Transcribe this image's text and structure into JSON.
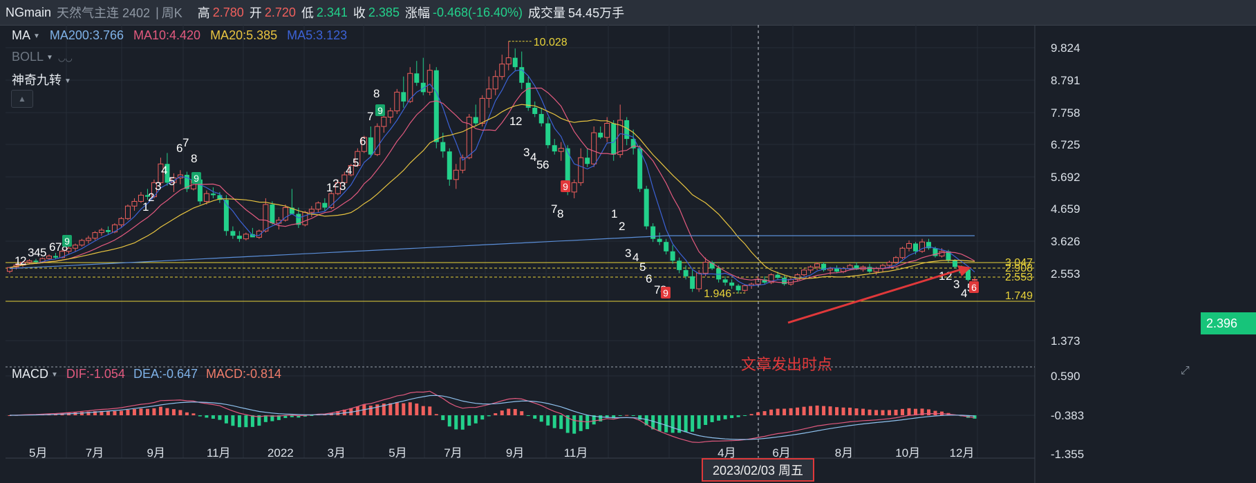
{
  "header": {
    "symbol": "NGmain",
    "name": "天然气主连 2402",
    "separator": "|",
    "period": "周K",
    "high_label": "高",
    "high": "2.780",
    "open_label": "开",
    "open": "2.720",
    "low_label": "低",
    "low": "2.341",
    "close_label": "收",
    "close": "2.385",
    "change_label": "涨幅",
    "change": "-0.468(-16.40%)",
    "volume_label": "成交量",
    "volume": "54.45万手"
  },
  "indicators": {
    "ma_label": "MA",
    "ma200": "MA200:3.766",
    "ma10": "MA10:4.420",
    "ma20": "MA20:5.385",
    "ma5": "MA5:3.123",
    "boll_label": "BOLL",
    "magic_label": "神奇九转"
  },
  "macd": {
    "label": "MACD",
    "dif": "DIF:-1.054",
    "dea": "DEA:-0.647",
    "macd": "MACD:-0.814"
  },
  "colors": {
    "up": "#f0605d",
    "down": "#23d18b",
    "ma200": "#5b8fd9",
    "ma10": "#e35a7f",
    "ma20": "#e8c440",
    "ma5": "#3c62d6"
  },
  "price_axis": [
    "9.824",
    "8.791",
    "7.758",
    "6.725",
    "5.692",
    "4.659",
    "3.626",
    "2.553"
  ],
  "macd_axis": [
    "1.373",
    "0.590",
    "-0.383",
    "-1.355"
  ],
  "current_price": "2.396",
  "levels": [
    {
      "label": "3.047",
      "value": 3.047
    },
    {
      "label": "2.908",
      "value": 2.908
    },
    {
      "label": "2.553",
      "value": 2.553
    },
    {
      "label": "1.749",
      "value": 1.749
    }
  ],
  "max_label": "10.028",
  "min_label": "1.946",
  "time_axis": [
    "5月",
    "7月",
    "9月",
    "11月",
    "2022",
    "3月",
    "5月",
    "7月",
    "9月",
    "11月",
    "4月",
    "6月",
    "8月",
    "10月",
    "12月"
  ],
  "crosshair_date": "2023/02/03 周五",
  "annotation": "文章发出时点",
  "nine_labels": [
    {
      "t": "1",
      "x": 21,
      "y": 378
    },
    {
      "t": "2",
      "x": 29,
      "y": 378
    },
    {
      "t": "3",
      "x": 40,
      "y": 366
    },
    {
      "t": "4",
      "x": 49,
      "y": 366
    },
    {
      "t": "5",
      "x": 58,
      "y": 366
    },
    {
      "t": "6",
      "x": 71,
      "y": 358
    },
    {
      "t": "7",
      "x": 80,
      "y": 358
    },
    {
      "t": "8",
      "x": 89,
      "y": 358
    },
    {
      "t": "1",
      "x": 206,
      "y": 300
    },
    {
      "t": "2",
      "x": 214,
      "y": 286
    },
    {
      "t": "3",
      "x": 224,
      "y": 270
    },
    {
      "t": "4",
      "x": 233,
      "y": 247
    },
    {
      "t": "5",
      "x": 244,
      "y": 263
    },
    {
      "t": "6",
      "x": 255,
      "y": 215
    },
    {
      "t": "7",
      "x": 264,
      "y": 207
    },
    {
      "t": "8",
      "x": 276,
      "y": 230
    },
    {
      "t": "1",
      "x": 472,
      "y": 272
    },
    {
      "t": "2",
      "x": 481,
      "y": 266
    },
    {
      "t": "3",
      "x": 491,
      "y": 270
    },
    {
      "t": "4",
      "x": 500,
      "y": 247
    },
    {
      "t": "5",
      "x": 510,
      "y": 236
    },
    {
      "t": "6",
      "x": 520,
      "y": 205
    },
    {
      "t": "7",
      "x": 531,
      "y": 169
    },
    {
      "t": "8",
      "x": 540,
      "y": 136
    },
    {
      "t": "1",
      "x": 737,
      "y": 176
    },
    {
      "t": "2",
      "x": 746,
      "y": 176
    },
    {
      "t": "3",
      "x": 757,
      "y": 221
    },
    {
      "t": "4",
      "x": 767,
      "y": 228
    },
    {
      "t": "5",
      "x": 776,
      "y": 239
    },
    {
      "t": "6",
      "x": 785,
      "y": 239
    },
    {
      "t": "7",
      "x": 797,
      "y": 303
    },
    {
      "t": "8",
      "x": 806,
      "y": 310
    },
    {
      "t": "1",
      "x": 884,
      "y": 310
    },
    {
      "t": "2",
      "x": 895,
      "y": 328
    },
    {
      "t": "3",
      "x": 904,
      "y": 367
    },
    {
      "t": "4",
      "x": 915,
      "y": 373
    },
    {
      "t": "5",
      "x": 925,
      "y": 387
    },
    {
      "t": "6",
      "x": 934,
      "y": 404
    },
    {
      "t": "7",
      "x": 946,
      "y": 420
    },
    {
      "t": "8",
      "x": 955,
      "y": 420
    },
    {
      "t": "1",
      "x": 1358,
      "y": 400
    },
    {
      "t": "2",
      "x": 1368,
      "y": 400
    },
    {
      "t": "3",
      "x": 1379,
      "y": 412
    },
    {
      "t": "4",
      "x": 1390,
      "y": 425
    },
    {
      "t": "5",
      "x": 1399,
      "y": 417
    }
  ],
  "nine_badges": [
    {
      "t": "9",
      "x": 97,
      "y": 349,
      "c": "#17a66b"
    },
    {
      "t": "9",
      "x": 284,
      "y": 258,
      "c": "#17a66b"
    },
    {
      "t": "9",
      "x": 550,
      "y": 160,
      "c": "#17a66b"
    },
    {
      "t": "9",
      "x": 818,
      "y": 270,
      "c": "#e0383a"
    },
    {
      "t": "9",
      "x": 963,
      "y": 424,
      "c": "#e0383a"
    },
    {
      "t": "6",
      "x": 1409,
      "y": 416,
      "c": "#e0383a"
    }
  ],
  "chart_data": {
    "type": "candlestick",
    "title": "NGmain 天然气主连 2402 周K",
    "period": "weekly",
    "x_range": [
      "2021-04",
      "2023-12"
    ],
    "y_range": [
      1.5,
      10.4
    ],
    "scale": "linear",
    "grid": true,
    "series": [
      {
        "name": "MA200",
        "last": 3.766
      },
      {
        "name": "MA10",
        "last": 4.42
      },
      {
        "name": "MA20",
        "last": 5.385
      },
      {
        "name": "MA5",
        "last": 3.123
      }
    ],
    "candles": [
      [
        2.66,
        2.8,
        2.6,
        2.78
      ],
      [
        2.8,
        2.92,
        2.72,
        2.86
      ],
      [
        2.86,
        2.98,
        2.8,
        2.95
      ],
      [
        2.95,
        3.05,
        2.88,
        3.0
      ],
      [
        3.0,
        3.06,
        2.9,
        2.96
      ],
      [
        2.96,
        3.1,
        2.92,
        3.07
      ],
      [
        3.07,
        3.2,
        3.02,
        3.15
      ],
      [
        3.15,
        3.25,
        3.05,
        3.1
      ],
      [
        3.1,
        3.35,
        3.08,
        3.3
      ],
      [
        3.3,
        3.45,
        3.22,
        3.4
      ],
      [
        3.4,
        3.55,
        3.3,
        3.5
      ],
      [
        3.5,
        3.7,
        3.45,
        3.65
      ],
      [
        3.65,
        3.8,
        3.55,
        3.72
      ],
      [
        3.72,
        3.95,
        3.66,
        3.9
      ],
      [
        3.9,
        4.05,
        3.8,
        3.98
      ],
      [
        3.98,
        4.1,
        3.85,
        3.92
      ],
      [
        3.92,
        4.2,
        3.88,
        4.15
      ],
      [
        4.15,
        4.4,
        4.08,
        4.35
      ],
      [
        4.35,
        4.8,
        4.3,
        4.75
      ],
      [
        4.75,
        5.0,
        4.6,
        4.9
      ],
      [
        4.9,
        5.2,
        4.85,
        5.1
      ],
      [
        5.1,
        5.3,
        4.95,
        5.05
      ],
      [
        5.05,
        5.6,
        5.0,
        5.5
      ],
      [
        5.5,
        6.3,
        5.4,
        6.1
      ],
      [
        6.1,
        6.45,
        5.4,
        5.5
      ],
      [
        5.5,
        5.8,
        5.2,
        5.65
      ],
      [
        5.65,
        5.9,
        5.45,
        5.75
      ],
      [
        5.75,
        5.85,
        5.2,
        5.3
      ],
      [
        5.3,
        5.7,
        5.25,
        5.6
      ],
      [
        5.6,
        5.75,
        4.8,
        4.9
      ],
      [
        4.9,
        5.25,
        4.8,
        5.15
      ],
      [
        5.15,
        5.35,
        5.0,
        5.1
      ],
      [
        5.1,
        5.2,
        4.85,
        4.95
      ],
      [
        4.95,
        5.1,
        3.8,
        3.95
      ],
      [
        3.95,
        4.1,
        3.7,
        3.8
      ],
      [
        3.8,
        3.95,
        3.6,
        3.7
      ],
      [
        3.7,
        3.9,
        3.65,
        3.85
      ],
      [
        3.85,
        4.05,
        3.8,
        3.75
      ],
      [
        3.75,
        4.0,
        3.7,
        3.95
      ],
      [
        3.95,
        5.0,
        3.9,
        4.8
      ],
      [
        4.8,
        4.9,
        4.15,
        4.2
      ],
      [
        4.2,
        4.4,
        4.0,
        4.3
      ],
      [
        4.3,
        4.8,
        4.25,
        4.7
      ],
      [
        4.7,
        5.3,
        4.6,
        4.5
      ],
      [
        4.5,
        4.7,
        4.05,
        4.15
      ],
      [
        4.15,
        4.6,
        4.1,
        4.55
      ],
      [
        4.55,
        4.75,
        4.4,
        4.65
      ],
      [
        4.65,
        4.9,
        4.55,
        4.85
      ],
      [
        4.85,
        5.0,
        4.6,
        4.7
      ],
      [
        4.7,
        5.2,
        4.65,
        5.15
      ],
      [
        5.15,
        5.6,
        5.1,
        5.5
      ],
      [
        5.5,
        5.85,
        5.4,
        5.75
      ],
      [
        5.75,
        6.1,
        5.7,
        6.05
      ],
      [
        6.05,
        6.6,
        6.0,
        6.5
      ],
      [
        6.5,
        7.0,
        6.45,
        6.95
      ],
      [
        6.95,
        7.3,
        6.3,
        6.4
      ],
      [
        6.4,
        7.4,
        6.35,
        7.3
      ],
      [
        7.3,
        7.7,
        7.1,
        7.6
      ],
      [
        7.6,
        7.9,
        7.4,
        7.8
      ],
      [
        7.8,
        8.5,
        7.7,
        8.4
      ],
      [
        8.4,
        8.9,
        7.9,
        8.1
      ],
      [
        8.1,
        9.2,
        8.05,
        9.0
      ],
      [
        9.0,
        9.4,
        8.6,
        8.7
      ],
      [
        8.7,
        9.5,
        8.3,
        8.4
      ],
      [
        8.4,
        9.3,
        8.3,
        9.1
      ],
      [
        9.1,
        9.2,
        6.6,
        6.8
      ],
      [
        6.8,
        7.1,
        6.3,
        6.5
      ],
      [
        6.5,
        6.6,
        5.4,
        5.6
      ],
      [
        5.6,
        6.1,
        5.3,
        5.9
      ],
      [
        5.9,
        6.4,
        5.8,
        6.3
      ],
      [
        6.3,
        7.7,
        6.25,
        7.6
      ],
      [
        7.6,
        8.0,
        7.3,
        7.4
      ],
      [
        7.4,
        8.3,
        7.3,
        8.2
      ],
      [
        8.2,
        8.9,
        7.9,
        8.5
      ],
      [
        8.5,
        9.1,
        8.3,
        8.9
      ],
      [
        8.9,
        9.6,
        8.8,
        9.3
      ],
      [
        9.3,
        10.03,
        9.1,
        9.5
      ],
      [
        9.5,
        9.8,
        9.1,
        9.2
      ],
      [
        9.2,
        9.7,
        8.5,
        8.7
      ],
      [
        8.7,
        8.9,
        7.8,
        7.9
      ],
      [
        7.9,
        8.1,
        7.6,
        7.7
      ],
      [
        7.7,
        7.9,
        7.3,
        7.4
      ],
      [
        7.4,
        7.6,
        6.6,
        6.7
      ],
      [
        6.7,
        6.9,
        6.4,
        6.5
      ],
      [
        6.5,
        6.8,
        6.2,
        6.6
      ],
      [
        6.6,
        6.7,
        5.1,
        5.2
      ],
      [
        5.2,
        5.6,
        5.0,
        5.5
      ],
      [
        5.5,
        6.6,
        5.4,
        6.3
      ],
      [
        6.3,
        6.6,
        6.0,
        6.1
      ],
      [
        6.1,
        7.3,
        6.0,
        7.1
      ],
      [
        7.1,
        7.3,
        6.9,
        6.95
      ],
      [
        6.95,
        7.6,
        6.8,
        7.4
      ],
      [
        7.4,
        7.5,
        6.2,
        6.4
      ],
      [
        6.4,
        8.0,
        6.3,
        7.5
      ],
      [
        7.5,
        7.6,
        6.7,
        6.9
      ],
      [
        6.9,
        7.2,
        6.4,
        6.6
      ],
      [
        6.6,
        6.7,
        5.2,
        5.3
      ],
      [
        5.3,
        5.4,
        4.0,
        4.1
      ],
      [
        4.1,
        4.2,
        3.6,
        3.7
      ],
      [
        3.7,
        3.9,
        3.5,
        3.6
      ],
      [
        3.6,
        3.7,
        3.2,
        3.3
      ],
      [
        3.3,
        3.5,
        2.9,
        3.0
      ],
      [
        3.0,
        3.1,
        2.6,
        2.7
      ],
      [
        2.7,
        2.85,
        2.4,
        2.5
      ],
      [
        2.5,
        2.7,
        2.0,
        2.1
      ],
      [
        2.1,
        2.7,
        2.0,
        2.6
      ],
      [
        2.6,
        3.1,
        2.5,
        2.95
      ],
      [
        2.95,
        3.0,
        2.7,
        2.75
      ],
      [
        2.75,
        2.85,
        2.3,
        2.4
      ],
      [
        2.4,
        2.5,
        2.2,
        2.3
      ],
      [
        2.3,
        2.4,
        2.1,
        2.2
      ],
      [
        2.2,
        2.25,
        1.95,
        2.05
      ],
      [
        2.05,
        2.25,
        2.0,
        2.2
      ],
      [
        2.2,
        2.3,
        2.1,
        2.25
      ],
      [
        2.25,
        2.5,
        2.2,
        2.4
      ],
      [
        2.4,
        2.5,
        2.25,
        2.3
      ],
      [
        2.3,
        2.6,
        2.25,
        2.55
      ],
      [
        2.55,
        2.65,
        2.4,
        2.45
      ],
      [
        2.45,
        2.55,
        2.2,
        2.25
      ],
      [
        2.25,
        2.45,
        2.2,
        2.4
      ],
      [
        2.4,
        2.6,
        2.35,
        2.55
      ],
      [
        2.55,
        2.75,
        2.5,
        2.7
      ],
      [
        2.7,
        2.85,
        2.6,
        2.8
      ],
      [
        2.8,
        2.95,
        2.7,
        2.9
      ],
      [
        2.9,
        2.95,
        2.65,
        2.7
      ],
      [
        2.7,
        2.8,
        2.55,
        2.75
      ],
      [
        2.75,
        2.85,
        2.6,
        2.65
      ],
      [
        2.65,
        2.8,
        2.6,
        2.75
      ],
      [
        2.75,
        2.9,
        2.7,
        2.85
      ],
      [
        2.85,
        2.95,
        2.7,
        2.72
      ],
      [
        2.72,
        2.85,
        2.65,
        2.8
      ],
      [
        2.8,
        2.9,
        2.6,
        2.65
      ],
      [
        2.65,
        2.8,
        2.55,
        2.75
      ],
      [
        2.75,
        2.9,
        2.65,
        2.85
      ],
      [
        2.85,
        3.0,
        2.75,
        2.95
      ],
      [
        2.95,
        3.15,
        2.9,
        3.1
      ],
      [
        3.1,
        3.45,
        3.05,
        3.4
      ],
      [
        3.4,
        3.65,
        3.3,
        3.55
      ],
      [
        3.55,
        3.6,
        3.2,
        3.3
      ],
      [
        3.3,
        3.7,
        3.25,
        3.6
      ],
      [
        3.6,
        3.7,
        3.35,
        3.4
      ],
      [
        3.4,
        3.45,
        3.1,
        3.15
      ],
      [
        3.15,
        3.4,
        3.1,
        3.3
      ],
      [
        3.3,
        3.35,
        2.95,
        3.0
      ],
      [
        3.0,
        3.05,
        2.75,
        2.8
      ],
      [
        2.8,
        2.85,
        2.55,
        2.6
      ],
      [
        2.72,
        2.78,
        2.34,
        2.385
      ],
      [
        2.385,
        2.45,
        2.35,
        2.396
      ]
    ],
    "macd": {
      "dif": -1.054,
      "dea": -0.647,
      "macd": -0.814,
      "y_range": [
        -1.355,
        1.373
      ]
    }
  }
}
